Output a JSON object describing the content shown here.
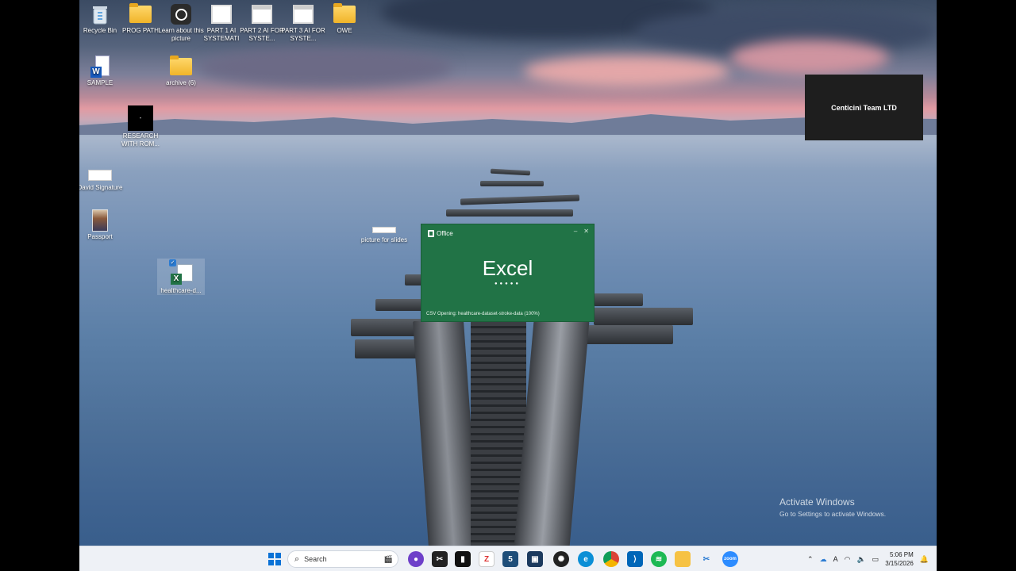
{
  "desktop": {
    "icons": [
      {
        "label": "Recycle Bin",
        "icon": "recycle-bin-icon"
      },
      {
        "label": "PROG PATH",
        "icon": "folder-icon"
      },
      {
        "label": "Learn about this picture",
        "icon": "learn-picture-icon"
      },
      {
        "label": "PART 1 AI SYSTEMATI",
        "icon": "video-file-icon"
      },
      {
        "label": "PART 2 AI FOR SYSTE...",
        "icon": "video-file-icon"
      },
      {
        "label": "PART 3 AI FOR SYSTE...",
        "icon": "video-file-icon"
      },
      {
        "label": "OWE",
        "icon": "folder-icon"
      },
      {
        "label": "SAMPLE",
        "icon": "word-document-icon"
      },
      {
        "label": "archive (6)",
        "icon": "folder-icon"
      },
      {
        "label": "RESEARCH WITH ROM...",
        "icon": "black-file-icon"
      },
      {
        "label": "David Signature",
        "icon": "image-file-icon"
      },
      {
        "label": "Passport",
        "icon": "photo-icon"
      },
      {
        "label": "picture for slides",
        "icon": "image-file-icon"
      },
      {
        "label": "healthcare-d...",
        "icon": "excel-csv-icon"
      }
    ]
  },
  "overlay": {
    "text": "Centicini Team LTD"
  },
  "splash": {
    "brand": "Office",
    "title": "Excel",
    "status": "CSV Opening: healthcare-dataset-stroke-data  (100%)"
  },
  "watermark": {
    "line1": "Activate Windows",
    "line2": "Go to Settings to activate Windows."
  },
  "taskbar": {
    "search_placeholder": "Search",
    "time": "5:06 PM",
    "date": "3/15/2026",
    "colors": {
      "excel_green": "#217346",
      "taskbar_bg": "#eef1f6"
    }
  }
}
